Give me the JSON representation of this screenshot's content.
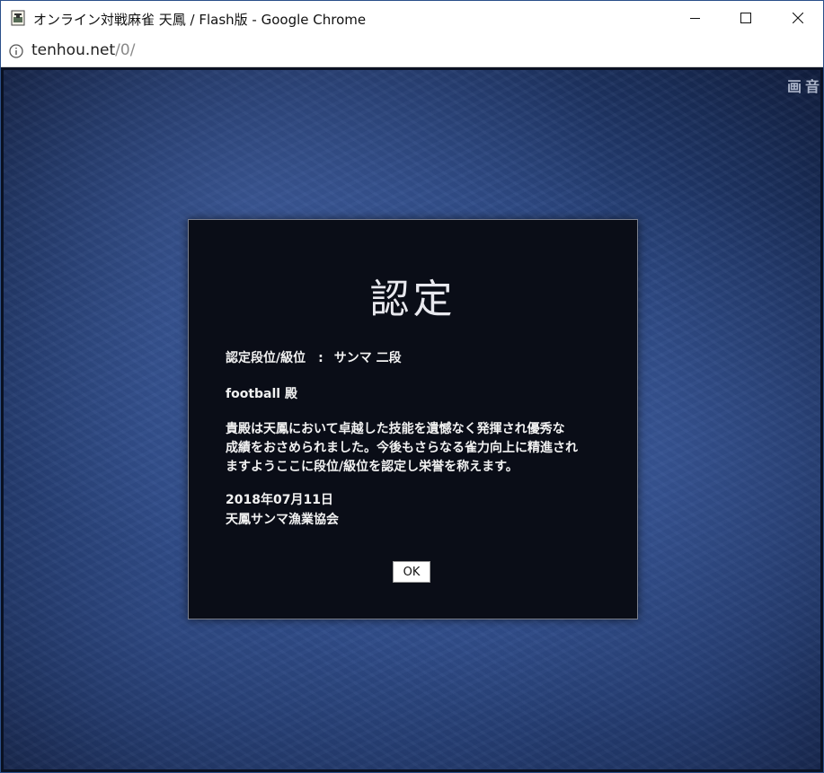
{
  "window": {
    "title": "オンライン対戦麻雀 天鳳 / Flash版 - Google Chrome",
    "controls": {
      "minimize": "minimize-icon",
      "maximize": "maximize-icon",
      "close": "close-icon"
    }
  },
  "address": {
    "host": "tenhou.net",
    "path": "/0/"
  },
  "game": {
    "top_controls": [
      "画",
      "音"
    ]
  },
  "dialog": {
    "title": "認定",
    "rank_label": "認定段位/級位",
    "rank_sep": ":",
    "rank_value": "サンマ 二段",
    "recipient": "football 殿",
    "message_lines": [
      "貴殿は天鳳において卓越した技能を遺憾なく発揮され優秀な",
      "成績をおさめられました。今後もさらなる雀力向上に精進され",
      "ますようここに段位/級位を認定し栄誉を称えます。"
    ],
    "date": "2018年07月11日",
    "organization": "天鳳サンマ漁業協会",
    "ok_label": "OK"
  },
  "colors": {
    "dialog_bg": "#0a0d17",
    "background": "#2a4680",
    "window_border": "#2b4f8a"
  }
}
